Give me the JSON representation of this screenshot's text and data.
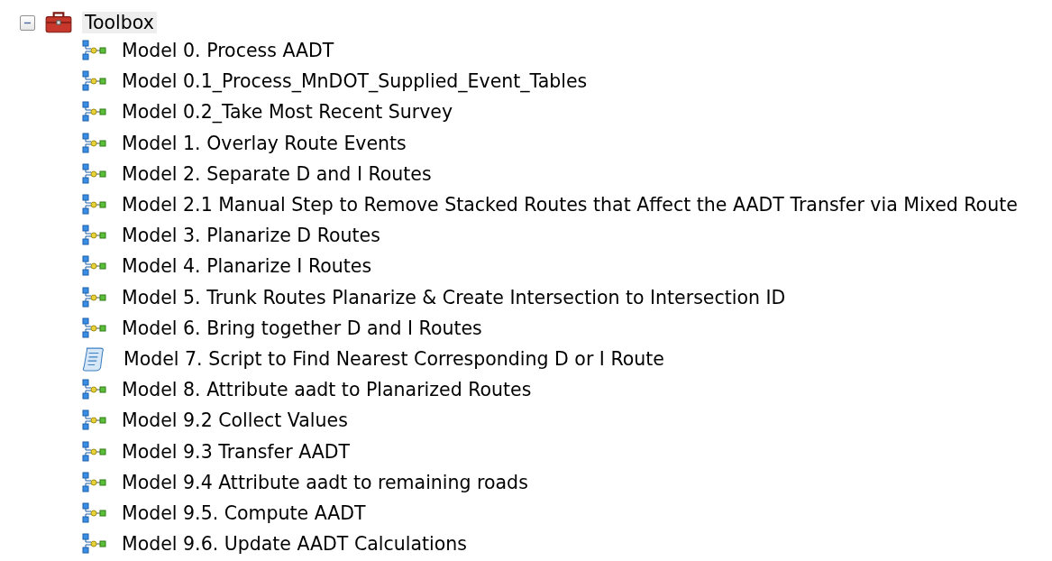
{
  "tree": {
    "label": "Toolbox",
    "expanded": true,
    "selected": true,
    "children": [
      {
        "label": "Model 0. Process AADT",
        "kind": "model",
        "selected": false
      },
      {
        "label": "Model 0.1_Process_MnDOT_Supplied_Event_Tables",
        "kind": "model",
        "selected": false
      },
      {
        "label": "Model 0.2_Take Most Recent Survey",
        "kind": "model",
        "selected": false
      },
      {
        "label": "Model 1. Overlay Route Events",
        "kind": "model",
        "selected": false
      },
      {
        "label": "Model 2. Separate D and I Routes",
        "kind": "model",
        "selected": false
      },
      {
        "label": "Model 2.1 Manual Step to Remove Stacked Routes that Affect the AADT Transfer via Mixed Route",
        "kind": "model",
        "selected": false
      },
      {
        "label": "Model 3. Planarize D Routes",
        "kind": "model",
        "selected": false
      },
      {
        "label": "Model 4. Planarize I Routes",
        "kind": "model",
        "selected": false
      },
      {
        "label": "Model 5. Trunk Routes Planarize & Create Intersection to Intersection ID",
        "kind": "model",
        "selected": false
      },
      {
        "label": "Model 6. Bring together D and I Routes",
        "kind": "model",
        "selected": false
      },
      {
        "label": "Model 7. Script to Find Nearest Corresponding D or I Route",
        "kind": "script",
        "selected": false
      },
      {
        "label": "Model 8. Attribute aadt to Planarized Routes",
        "kind": "model",
        "selected": false
      },
      {
        "label": "Model 9.2 Collect Values",
        "kind": "model",
        "selected": false
      },
      {
        "label": "Model 9.3 Transfer AADT",
        "kind": "model",
        "selected": false
      },
      {
        "label": "Model 9.4 Attribute aadt to remaining roads",
        "kind": "model",
        "selected": false
      },
      {
        "label": "Model 9.5. Compute AADT",
        "kind": "model",
        "selected": false
      },
      {
        "label": "Model 9.6. Update AADT Calculations",
        "kind": "model",
        "selected": false
      }
    ]
  }
}
